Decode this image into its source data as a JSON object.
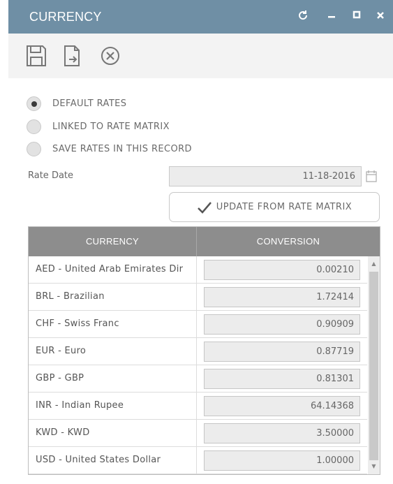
{
  "window": {
    "title": "CURRENCY",
    "controls": [
      "refresh-icon",
      "minimize-icon",
      "maximize-icon",
      "close-icon"
    ]
  },
  "toolbar": {
    "buttons": [
      "save-icon",
      "export-icon",
      "cancel-icon"
    ]
  },
  "rate_options": [
    {
      "label": "DEFAULT RATES",
      "selected": true
    },
    {
      "label": "LINKED TO RATE MATRIX",
      "selected": false
    },
    {
      "label": "SAVE RATES IN THIS RECORD",
      "selected": false
    }
  ],
  "rate_date": {
    "label": "Rate Date",
    "value": "11-18-2016"
  },
  "update_button": {
    "label": "UPDATE FROM RATE MATRIX"
  },
  "grid": {
    "columns": [
      "CURRENCY",
      "CONVERSION"
    ],
    "rows": [
      {
        "currency": "AED - United Arab Emirates Dir",
        "conversion": "0.00210"
      },
      {
        "currency": "BRL - Brazilian",
        "conversion": "1.72414"
      },
      {
        "currency": "CHF - Swiss Franc",
        "conversion": "0.90909"
      },
      {
        "currency": "EUR - Euro",
        "conversion": "0.87719"
      },
      {
        "currency": "GBP - GBP",
        "conversion": "0.81301"
      },
      {
        "currency": "INR - Indian Rupee",
        "conversion": "64.14368"
      },
      {
        "currency": "KWD - KWD",
        "conversion": "3.50000"
      },
      {
        "currency": "USD - United States Dollar",
        "conversion": "1.00000"
      }
    ]
  },
  "colors": {
    "titlebar": "#6f8fa5",
    "toolbar": "#f3f3f3",
    "grid_header": "#8d8d8d",
    "check": "#555555"
  }
}
